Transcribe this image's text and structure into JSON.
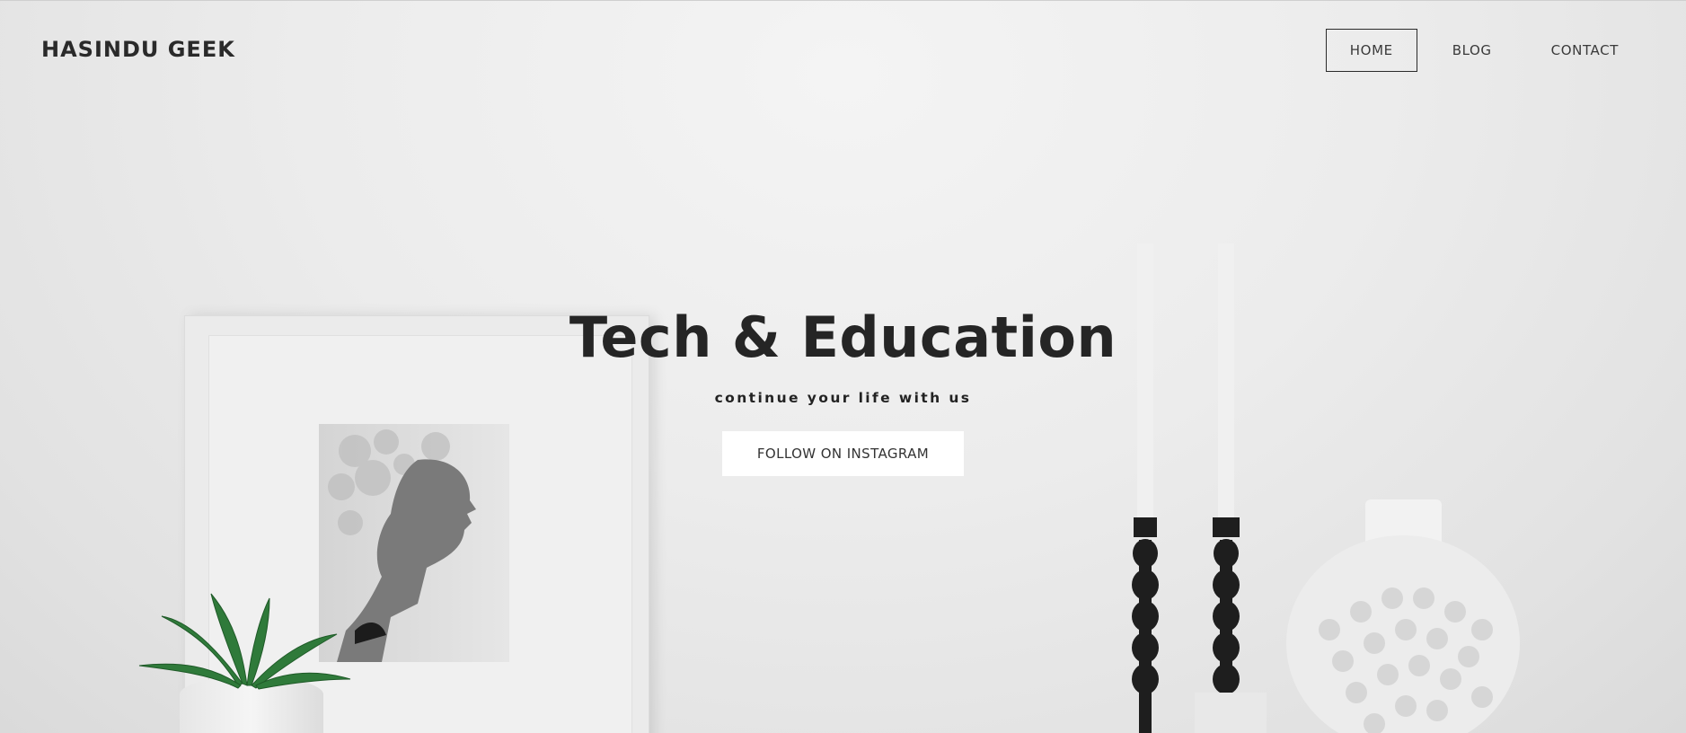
{
  "brand": {
    "name": "HASINDU GEEK"
  },
  "nav": {
    "items": [
      {
        "label": "HOME",
        "active": true
      },
      {
        "label": "BLOG",
        "active": false
      },
      {
        "label": "CONTACT",
        "active": false
      }
    ]
  },
  "hero": {
    "headline": "Tech & Education",
    "tagline": "continue your life with us",
    "cta_label": "FOLLOW ON INSTAGRAM"
  },
  "colors": {
    "text": "#252525",
    "background": "#e9e9e9",
    "button_bg": "#ffffff"
  }
}
